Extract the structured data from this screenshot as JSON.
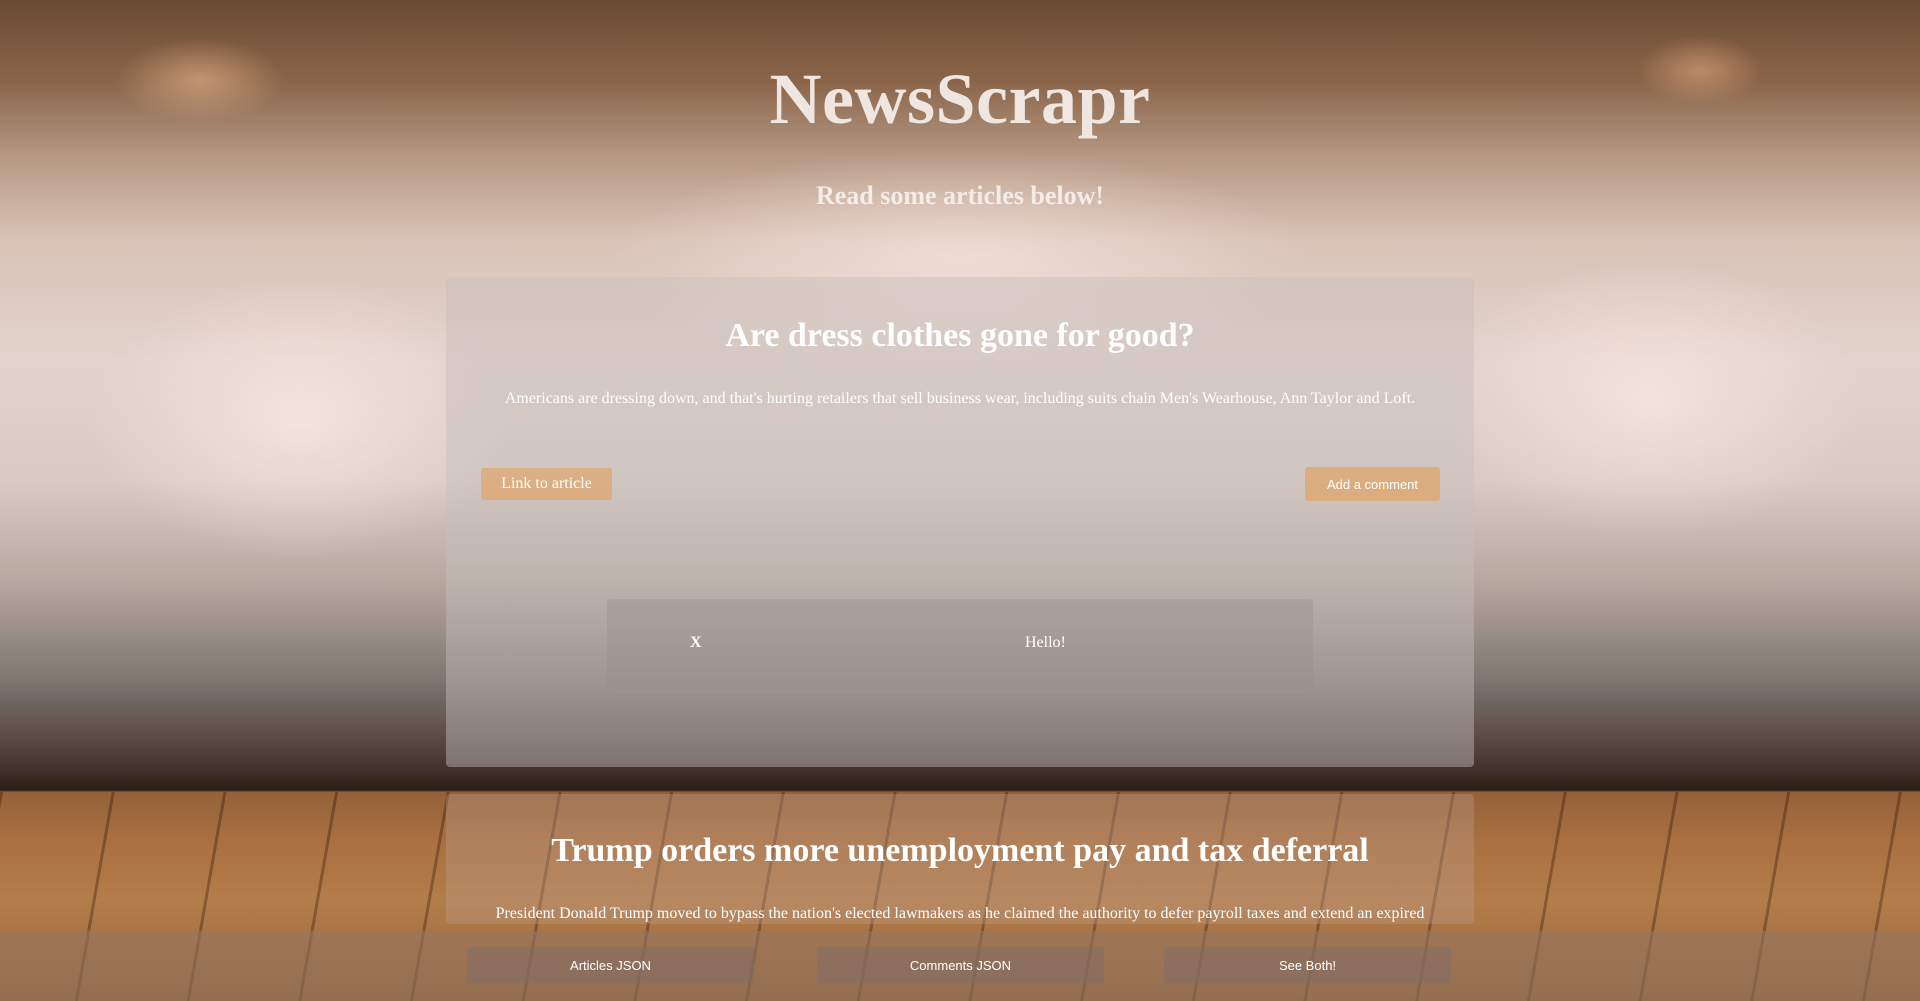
{
  "header": {
    "title": "NewsScrapr",
    "subtitle": "Read some articles below!"
  },
  "articles": [
    {
      "title": "Are dress clothes gone for good?",
      "summary": "Americans are dressing down, and that's hurting retailers that sell business wear, including suits chain Men's Wearhouse, Ann Taylor and Loft.",
      "link_label": "Link to article",
      "comment_label": "Add a comment",
      "comments": [
        {
          "delete_label": "X",
          "text": "Hello!"
        }
      ]
    },
    {
      "title": "Trump orders more unemployment pay and tax deferral",
      "summary": "President Donald Trump moved to bypass the nation's elected lawmakers as he claimed the authority to defer payroll taxes and extend an expired"
    }
  ],
  "footer": {
    "articles_json": "Articles JSON",
    "comments_json": "Comments JSON",
    "see_both": "See Both!"
  },
  "colors": {
    "accent_button": "#dcaa78",
    "title_text": "#efe6e2"
  }
}
